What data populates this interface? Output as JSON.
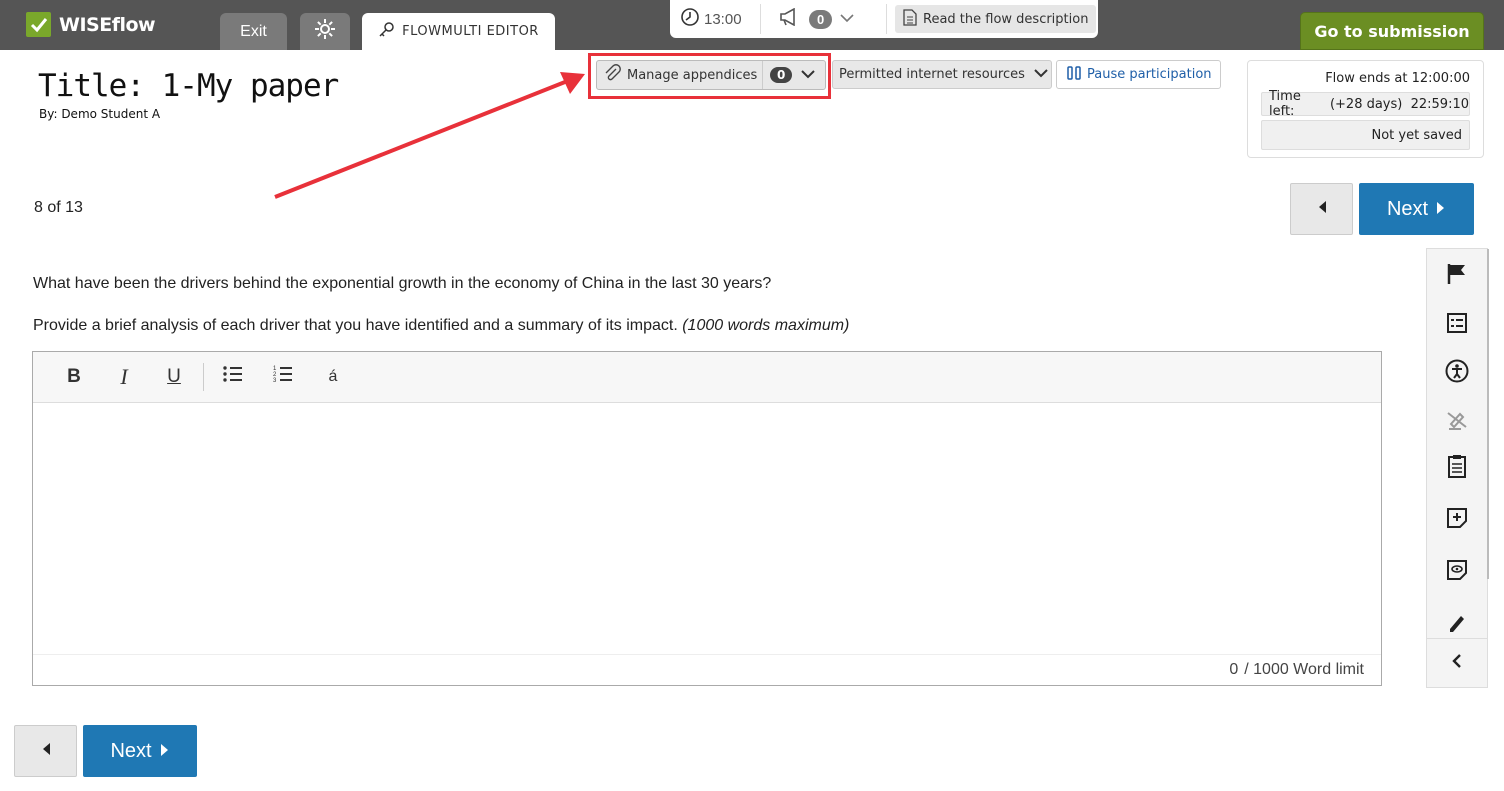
{
  "app": {
    "logo": "WISEflow"
  },
  "tabs": {
    "exit": "Exit",
    "editor": "FLOWMULTI EDITOR"
  },
  "status_bar": {
    "clock": "13:00",
    "announcements": "0",
    "read_description": "Read the flow description"
  },
  "submission": {
    "label": "Go to submission"
  },
  "paper": {
    "title": "Title: 1-My paper",
    "byline": "By: Demo Student A"
  },
  "actions": {
    "manage_appendices": "Manage appendices",
    "appendices_count": "0",
    "permitted_resources": "Permitted internet resources",
    "pause": "Pause participation"
  },
  "flow": {
    "ends": "Flow ends at 12:00:00",
    "time_left_label": "Time left:",
    "time_left_value": "(+28 days)  22:59:10",
    "save_status": "Not yet saved"
  },
  "navigation": {
    "counter": "8 of 13",
    "next": "Next"
  },
  "content": {
    "question": "What have been the drivers behind the exponential growth in the economy of China in the last 30 years?",
    "instruction": "Provide a brief analysis of each driver that you have identified and a summary of its impact.",
    "instruction_note": "(1000 words maximum)"
  },
  "editor": {
    "toolbar": {
      "bold": "B",
      "italic": "I",
      "underline": "U",
      "special_char": "á"
    },
    "word_count": "0",
    "word_limit": "/ 1000 Word limit"
  },
  "colors": {
    "accent_blue": "#1f78b4",
    "brand_green": "#6b8e23",
    "highlight_red": "#e8313a",
    "topbar": "#555555"
  }
}
